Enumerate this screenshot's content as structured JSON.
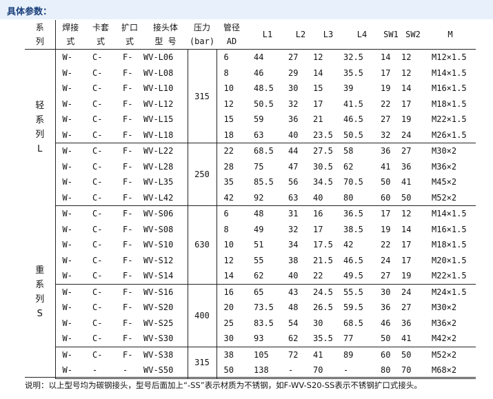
{
  "title": "具体参数：",
  "headers": {
    "series": "系\n列",
    "weld": "焊接\n式",
    "sleeve": "卡套\n式",
    "flare": "扩口\n式",
    "model": "接头体\n型 号",
    "pressure": "压力\n(bar)",
    "ad": "管径\nAD",
    "l1": "L1",
    "l2": "L2",
    "l3": "L3",
    "l4": "L4",
    "sw1": "SW1",
    "sw2": "SW2",
    "m": "M"
  },
  "series": [
    {
      "name": "轻\n系\n列\nL"
    },
    {
      "name": "重\n系\n列\nS"
    }
  ],
  "pressure_groups": [
    "315",
    "250",
    "630",
    "400",
    "315"
  ],
  "rows": [
    {
      "weld": "W-",
      "sleeve": "C-",
      "flare": "F-",
      "model": "WV-L06",
      "ad": "6",
      "l1": "44",
      "l2": "27",
      "l3": "12",
      "l4": "32.5",
      "sw1": "14",
      "sw2": "12",
      "m": "M12×1.5"
    },
    {
      "weld": "W-",
      "sleeve": "C-",
      "flare": "F-",
      "model": "WV-L08",
      "ad": "8",
      "l1": "46",
      "l2": "29",
      "l3": "14",
      "l4": "35.5",
      "sw1": "17",
      "sw2": "12",
      "m": "M14×1.5"
    },
    {
      "weld": "W-",
      "sleeve": "C-",
      "flare": "F-",
      "model": "WV-L10",
      "ad": "10",
      "l1": "48.5",
      "l2": "30",
      "l3": "15",
      "l4": "39",
      "sw1": "19",
      "sw2": "14",
      "m": "M16×1.5"
    },
    {
      "weld": "W-",
      "sleeve": "C-",
      "flare": "F-",
      "model": "WV-L12",
      "ad": "12",
      "l1": "50.5",
      "l2": "32",
      "l3": "17",
      "l4": "41.5",
      "sw1": "22",
      "sw2": "17",
      "m": "M18×1.5"
    },
    {
      "weld": "W-",
      "sleeve": "C-",
      "flare": "F-",
      "model": "WV-L15",
      "ad": "15",
      "l1": "59",
      "l2": "36",
      "l3": "21",
      "l4": "46.5",
      "sw1": "27",
      "sw2": "19",
      "m": "M22×1.5"
    },
    {
      "weld": "W-",
      "sleeve": "C-",
      "flare": "F-",
      "model": "WV-L18",
      "ad": "18",
      "l1": "63",
      "l2": "40",
      "l3": "23.5",
      "l4": "50.5",
      "sw1": "32",
      "sw2": "24",
      "m": "M26×1.5"
    },
    {
      "weld": "W-",
      "sleeve": "C-",
      "flare": "F-",
      "model": "WV-L22",
      "ad": "22",
      "l1": "68.5",
      "l2": "44",
      "l3": "27.5",
      "l4": "58",
      "sw1": "36",
      "sw2": "27",
      "m": "M30×2"
    },
    {
      "weld": "W-",
      "sleeve": "C-",
      "flare": "F-",
      "model": "WV-L28",
      "ad": "28",
      "l1": "75",
      "l2": "47",
      "l3": "30.5",
      "l4": "62",
      "sw1": "41",
      "sw2": "36",
      "m": "M36×2"
    },
    {
      "weld": "W-",
      "sleeve": "C-",
      "flare": "F-",
      "model": "WV-L35",
      "ad": "35",
      "l1": "85.5",
      "l2": "56",
      "l3": "34.5",
      "l4": "70.5",
      "sw1": "50",
      "sw2": "41",
      "m": "M45×2"
    },
    {
      "weld": "W-",
      "sleeve": "C-",
      "flare": "F-",
      "model": "WV-L42",
      "ad": "42",
      "l1": "92",
      "l2": "63",
      "l3": "40",
      "l4": "80",
      "sw1": "60",
      "sw2": "50",
      "m": "M52×2"
    },
    {
      "weld": "W-",
      "sleeve": "C-",
      "flare": "F-",
      "model": "WV-S06",
      "ad": "6",
      "l1": "48",
      "l2": "31",
      "l3": "16",
      "l4": "36.5",
      "sw1": "17",
      "sw2": "12",
      "m": "M14×1.5"
    },
    {
      "weld": "W-",
      "sleeve": "C-",
      "flare": "F-",
      "model": "WV-S08",
      "ad": "8",
      "l1": "49",
      "l2": "32",
      "l3": "17",
      "l4": "38.5",
      "sw1": "19",
      "sw2": "14",
      "m": "M16×1.5"
    },
    {
      "weld": "W-",
      "sleeve": "C-",
      "flare": "F-",
      "model": "WV-S10",
      "ad": "10",
      "l1": "51",
      "l2": "34",
      "l3": "17.5",
      "l4": "42",
      "sw1": "22",
      "sw2": "17",
      "m": "M18×1.5"
    },
    {
      "weld": "W-",
      "sleeve": "C-",
      "flare": "F-",
      "model": "WV-S12",
      "ad": "12",
      "l1": "55",
      "l2": "38",
      "l3": "21.5",
      "l4": "46.5",
      "sw1": "24",
      "sw2": "17",
      "m": "M20×1.5"
    },
    {
      "weld": "W-",
      "sleeve": "C-",
      "flare": "F-",
      "model": "WV-S14",
      "ad": "14",
      "l1": "62",
      "l2": "40",
      "l3": "22",
      "l4": "49.5",
      "sw1": "27",
      "sw2": "19",
      "m": "M22×1.5"
    },
    {
      "weld": "W-",
      "sleeve": "C-",
      "flare": "F-",
      "model": "WV-S16",
      "ad": "16",
      "l1": "65",
      "l2": "43",
      "l3": "24.5",
      "l4": "55.5",
      "sw1": "30",
      "sw2": "24",
      "m": "M24×1.5"
    },
    {
      "weld": "W-",
      "sleeve": "C-",
      "flare": "F-",
      "model": "WV-S20",
      "ad": "20",
      "l1": "73.5",
      "l2": "48",
      "l3": "26.5",
      "l4": "59.5",
      "sw1": "36",
      "sw2": "27",
      "m": "M30×2"
    },
    {
      "weld": "W-",
      "sleeve": "C-",
      "flare": "F-",
      "model": "WV-S25",
      "ad": "25",
      "l1": "83.5",
      "l2": "54",
      "l3": "30",
      "l4": "68.5",
      "sw1": "46",
      "sw2": "36",
      "m": "M36×2"
    },
    {
      "weld": "W-",
      "sleeve": "C-",
      "flare": "F-",
      "model": "WV-S30",
      "ad": "30",
      "l1": "93",
      "l2": "62",
      "l3": "35.5",
      "l4": "77",
      "sw1": "50",
      "sw2": "41",
      "m": "M42×2"
    },
    {
      "weld": "W-",
      "sleeve": "C-",
      "flare": "F-",
      "model": "WV-S38",
      "ad": "38",
      "l1": "105",
      "l2": "72",
      "l3": "41",
      "l4": "89",
      "sw1": "60",
      "sw2": "50",
      "m": "M52×2"
    },
    {
      "weld": "W-",
      "sleeve": "-",
      "flare": "-",
      "model": "WV-S50",
      "ad": "50",
      "l1": "138",
      "l2": "-",
      "l3": "70",
      "l4": "-",
      "sw1": "80",
      "sw2": "70",
      "m": "M68×2"
    }
  ],
  "note": "说明：以上型号均为碳钢接头，型号后面加上“-SS”表示材质为不锈钢，如F-WV-S20-SS表示不锈钢扩口式接头。"
}
